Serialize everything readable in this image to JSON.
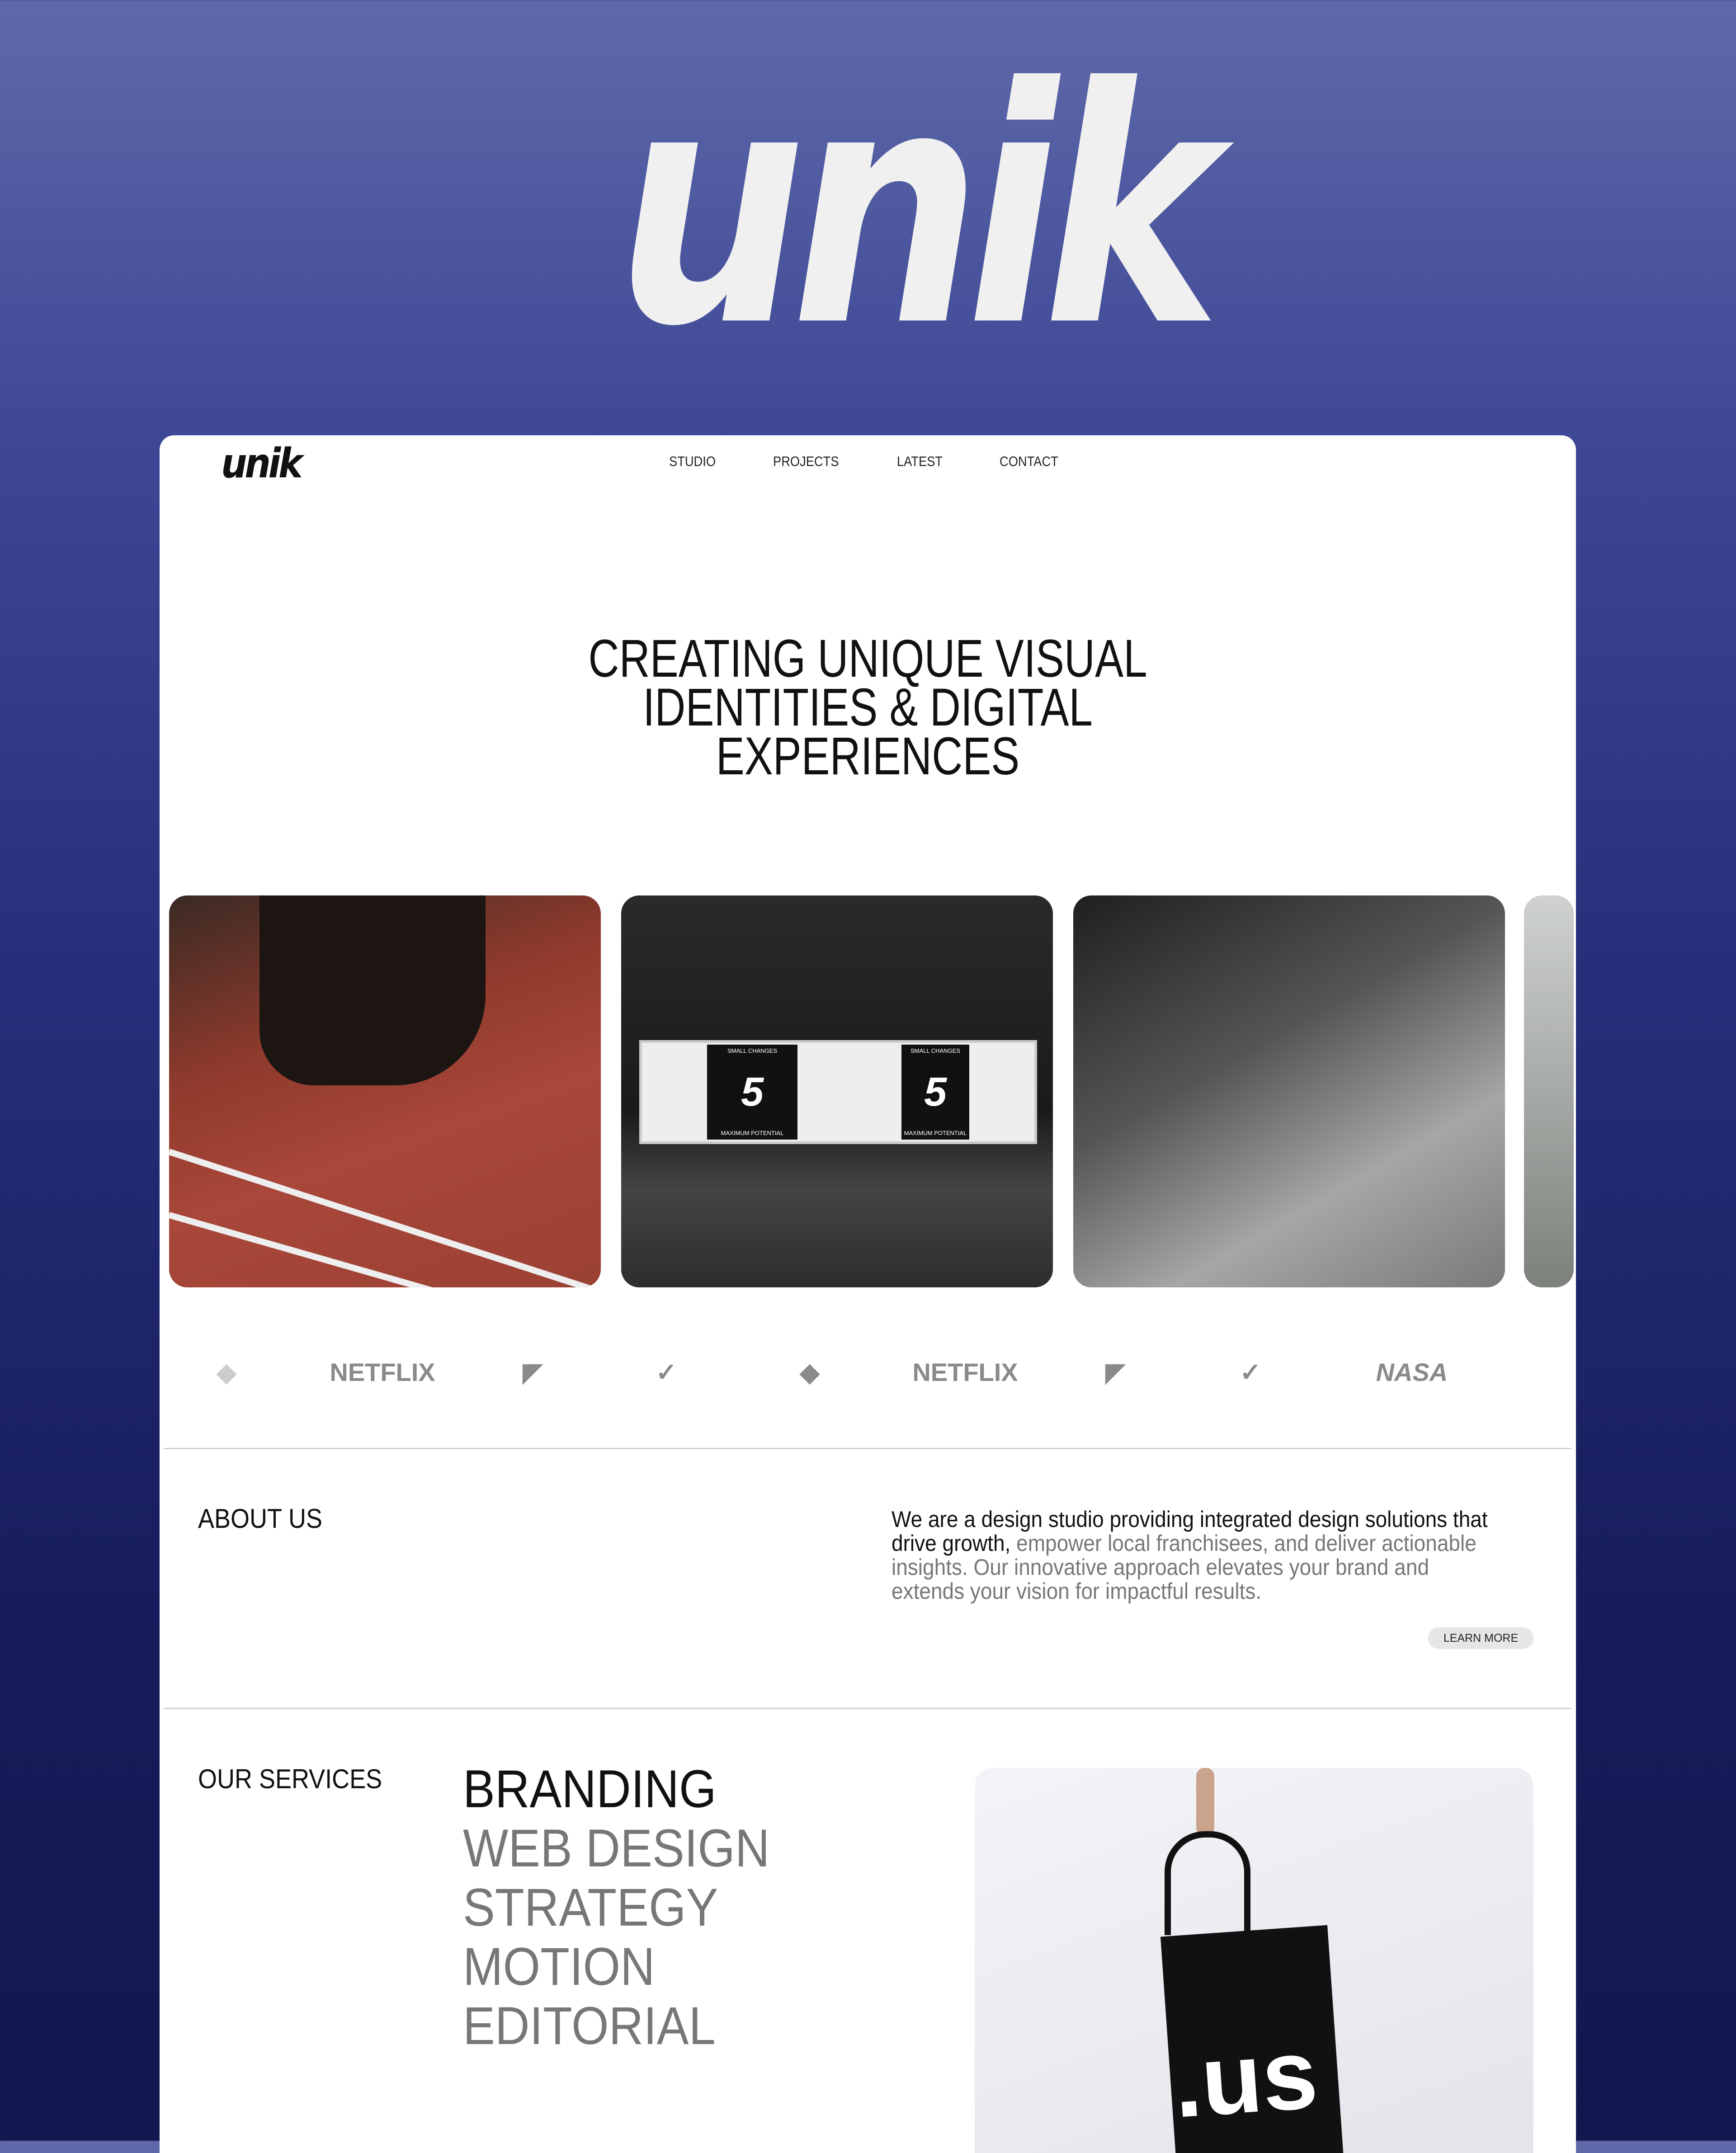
{
  "brand": {
    "logo": "unik"
  },
  "nav": {
    "items": [
      "STUDIO",
      "PROJECTS",
      "LATEST",
      "CONTACT"
    ]
  },
  "hero": {
    "lines": [
      "CREATING UNIQUE VISUAL",
      "IDENTITIES & DIGITAL",
      "EXPERIENCES"
    ]
  },
  "gallery": [
    "running-track-sprinter",
    "billboard-small-changes",
    "skateboarder-ramp",
    "guitar-room"
  ],
  "billboard": {
    "text": "5",
    "small": "SMALL CHANGES",
    "sub": "MAXIMUM POTENTIAL"
  },
  "clients": [
    "dropbox",
    "NETFLIX",
    "framer",
    "nike",
    "dropbox",
    "NETFLIX",
    "framer",
    "nike",
    "NASA"
  ],
  "about": {
    "label": "ABOUT US",
    "text_dark": "We are a design studio providing integrated design solutions that drive growth,",
    "text_light": " empower local franchisees, and deliver actionable insights. Our innovative approach elevates your brand and extends your vision for impactful results.",
    "button": "LEARN MORE"
  },
  "services": {
    "label": "OUR SERVICES",
    "items": [
      "BRANDING",
      "WEB DESIGN",
      "STRATEGY",
      "MOTION",
      "EDITORIAL"
    ],
    "bag_text": ".us"
  },
  "colors": {
    "bg_top": "#5f69a9",
    "bg_bottom": "#12174f",
    "text": "#111111",
    "muted": "#777777"
  }
}
